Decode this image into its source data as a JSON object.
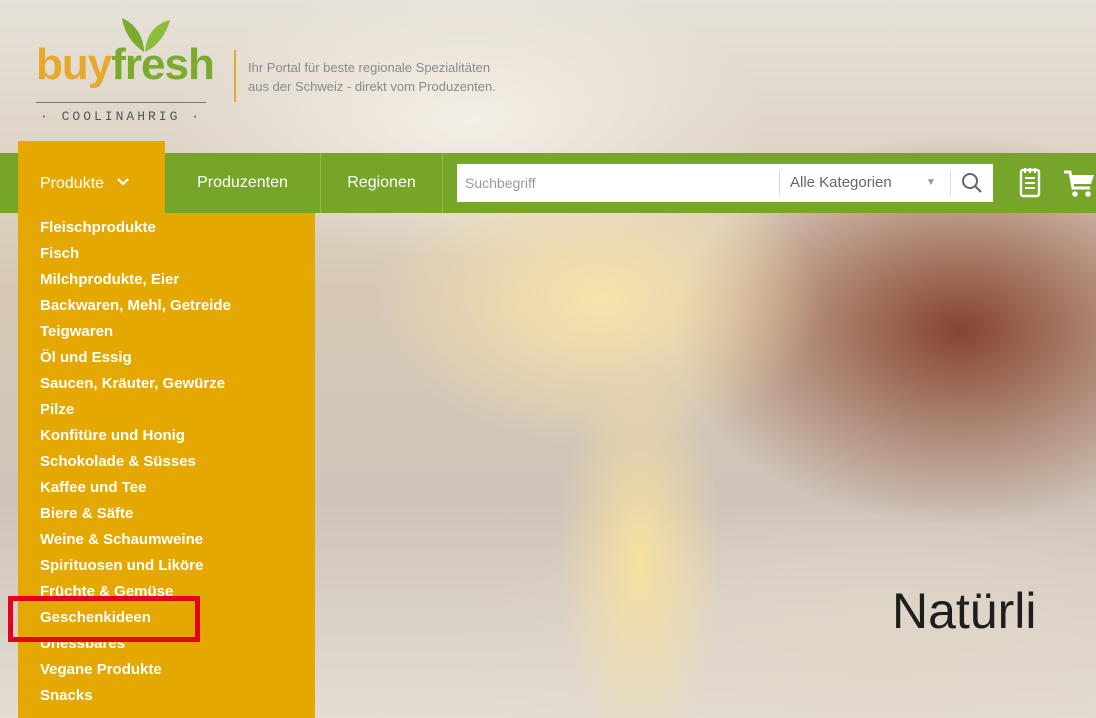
{
  "brand": {
    "name_part1": "buy",
    "name_part2": "fresh",
    "sub": "· COOLINAHRIG ·",
    "tagline_line1": "Ihr Portal für beste regionale Spezialitäten",
    "tagline_line2": "aus der Schweiz - direkt vom Produzenten."
  },
  "nav": {
    "produkte": "Produkte",
    "produzenten": "Produzenten",
    "regionen": "Regionen"
  },
  "search": {
    "placeholder": "Suchbegriff",
    "category": "Alle Kategorien"
  },
  "dropdown": {
    "items": [
      "Fleischprodukte",
      "Fisch",
      "Milchprodukte, Eier",
      "Backwaren, Mehl, Getreide",
      "Teigwaren",
      "Öl und Essig",
      "Saucen, Kräuter, Gewürze",
      "Pilze",
      "Konfitüre und Honig",
      "Schokolade & Süsses",
      "Kaffee und Tee",
      "Biere & Säfte",
      "Weine & Schaumweine",
      "Spirituosen und Liköre",
      "Früchte & Gemüse",
      "Geschenkideen",
      "Unessbares",
      "Vegane Produkte",
      "Snacks"
    ]
  },
  "hero": {
    "text": "Natürli"
  },
  "colors": {
    "nav_green": "#76a52a",
    "accent_orange": "#e5a800",
    "highlight_red": "#e5001c"
  },
  "icons": [
    "leaf-logo-icon",
    "chevron-down-icon",
    "search-icon",
    "notepad-icon",
    "cart-icon",
    "caret-down-icon"
  ]
}
